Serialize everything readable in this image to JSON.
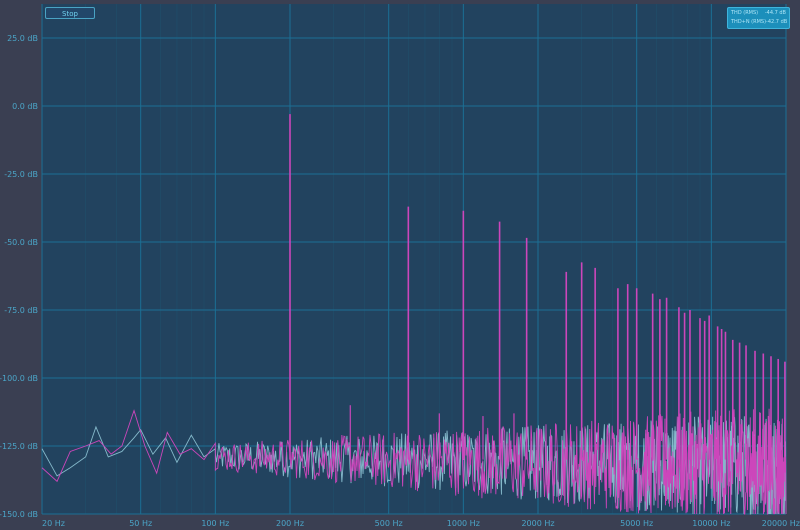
{
  "controls": {
    "stop_label": "Stop"
  },
  "thd_panel": {
    "rows": [
      {
        "label": "THD (RMS)",
        "value": "-44.7 dB"
      },
      {
        "label": "THD+N (RMS)",
        "value": "-42.7 dB"
      }
    ]
  },
  "chart_data": {
    "type": "line",
    "title": "",
    "xlabel": "",
    "ylabel": "",
    "x_scale": "log",
    "xlim": [
      20,
      20000
    ],
    "ylim": [
      -150,
      37.5
    ],
    "grid": true,
    "x_ticks": [
      20,
      50,
      100,
      200,
      500,
      1000,
      2000,
      5000,
      10000,
      20000
    ],
    "x_tick_labels": [
      "20 Hz",
      "50 Hz",
      "100 Hz",
      "200 Hz",
      "500 Hz",
      "1000 Hz",
      "2000 Hz",
      "5000 Hz",
      "10000 Hz",
      "20000 Hz"
    ],
    "y_ticks": [
      25,
      0,
      -25,
      -50,
      -75,
      -100,
      -125,
      -150
    ],
    "y_tick_labels": [
      "25.0 dB",
      "0.0 dB",
      "-25.0 dB",
      "-50.0 dB",
      "-75.0 dB",
      "-100.0 dB",
      "-125.0 dB",
      "-150.0 dB"
    ],
    "colors": {
      "background": "#22435f",
      "grid": "#1c6f94",
      "tick_label": "#4ba6c9",
      "magenta": "#cc46bb",
      "cyan": "#8fc5d6"
    },
    "noise_floor_db": -135,
    "magenta_peaks": [
      {
        "freq": 200,
        "db": -3
      },
      {
        "freq": 600,
        "db": -37
      },
      {
        "freq": 1000,
        "db": -38.5
      },
      {
        "freq": 1400,
        "db": -42.5
      },
      {
        "freq": 1800,
        "db": -48.5
      },
      {
        "freq": 2600,
        "db": -61
      },
      {
        "freq": 3000,
        "db": -57.5
      },
      {
        "freq": 3400,
        "db": -59.5
      },
      {
        "freq": 4200,
        "db": -67
      },
      {
        "freq": 4600,
        "db": -65.5
      },
      {
        "freq": 5000,
        "db": -67
      },
      {
        "freq": 5800,
        "db": -69
      },
      {
        "freq": 6200,
        "db": -71
      },
      {
        "freq": 6600,
        "db": -70.5
      },
      {
        "freq": 7400,
        "db": -74
      },
      {
        "freq": 7800,
        "db": -76
      },
      {
        "freq": 8200,
        "db": -75
      },
      {
        "freq": 9000,
        "db": -78
      },
      {
        "freq": 9400,
        "db": -79
      },
      {
        "freq": 9800,
        "db": -77
      },
      {
        "freq": 10600,
        "db": -81
      },
      {
        "freq": 11000,
        "db": -82
      },
      {
        "freq": 11400,
        "db": -83
      },
      {
        "freq": 12200,
        "db": -86
      },
      {
        "freq": 13000,
        "db": -87
      },
      {
        "freq": 13800,
        "db": -88
      },
      {
        "freq": 15000,
        "db": -90
      },
      {
        "freq": 16200,
        "db": -91
      },
      {
        "freq": 17400,
        "db": -92
      },
      {
        "freq": 18600,
        "db": -93
      },
      {
        "freq": 19800,
        "db": -94
      }
    ],
    "magenta_spurs": [
      {
        "freq": 350,
        "db": -110
      },
      {
        "freq": 800,
        "db": -113
      },
      {
        "freq": 1200,
        "db": -114
      },
      {
        "freq": 1600,
        "db": -113
      }
    ],
    "low_freq_magenta": [
      {
        "freq": 20,
        "db": -133
      },
      {
        "freq": 23,
        "db": -138
      },
      {
        "freq": 26,
        "db": -127
      },
      {
        "freq": 30,
        "db": -125
      },
      {
        "freq": 34,
        "db": -123
      },
      {
        "freq": 38,
        "db": -128
      },
      {
        "freq": 42,
        "db": -125
      },
      {
        "freq": 47,
        "db": -112
      },
      {
        "freq": 52,
        "db": -125
      },
      {
        "freq": 58,
        "db": -135
      },
      {
        "freq": 64,
        "db": -120
      },
      {
        "freq": 72,
        "db": -128
      },
      {
        "freq": 80,
        "db": -126
      },
      {
        "freq": 90,
        "db": -130
      },
      {
        "freq": 100,
        "db": -124
      }
    ],
    "low_freq_cyan": [
      {
        "freq": 20,
        "db": -126
      },
      {
        "freq": 23,
        "db": -136
      },
      {
        "freq": 26,
        "db": -133
      },
      {
        "freq": 30,
        "db": -129
      },
      {
        "freq": 33,
        "db": -118
      },
      {
        "freq": 37,
        "db": -129
      },
      {
        "freq": 42,
        "db": -127
      },
      {
        "freq": 47,
        "db": -122
      },
      {
        "freq": 50,
        "db": -119
      },
      {
        "freq": 56,
        "db": -128
      },
      {
        "freq": 63,
        "db": -122
      },
      {
        "freq": 70,
        "db": -131
      },
      {
        "freq": 80,
        "db": -121
      },
      {
        "freq": 90,
        "db": -129
      },
      {
        "freq": 100,
        "db": -126
      }
    ]
  }
}
